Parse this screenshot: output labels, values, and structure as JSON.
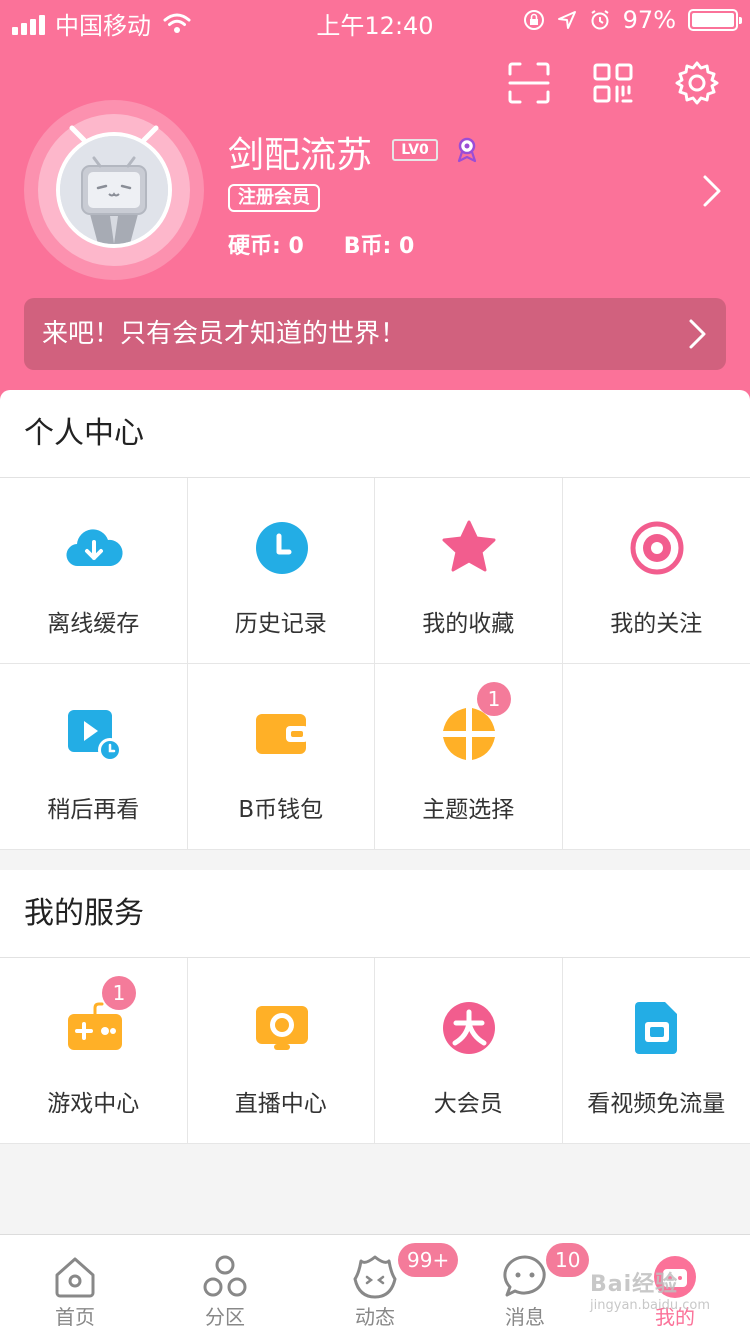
{
  "status_bar": {
    "carrier": "中国移动",
    "time": "上午12:40",
    "battery": "97%"
  },
  "profile": {
    "username": "剑配流苏",
    "level": "LV0",
    "member_tag": "注册会员",
    "coins_label": "硬币: 0",
    "bcoins_label": "B币: 0"
  },
  "vip_banner": {
    "text": "来吧！只有会员才知道的世界！"
  },
  "personal_center": {
    "title": "个人中心",
    "items": [
      {
        "label": "离线缓存",
        "icon": "download-cloud-icon",
        "color": "#23ade5"
      },
      {
        "label": "历史记录",
        "icon": "clock-icon",
        "color": "#23ade5"
      },
      {
        "label": "我的收藏",
        "icon": "star-icon",
        "color": "#f25d8e"
      },
      {
        "label": "我的关注",
        "icon": "follow-target-icon",
        "color": "#f25d8e"
      },
      {
        "label": "稍后再看",
        "icon": "watch-later-icon",
        "color": "#23ade5"
      },
      {
        "label": "B币钱包",
        "icon": "wallet-icon",
        "color": "#ffb027"
      },
      {
        "label": "主题选择",
        "icon": "theme-icon",
        "color": "#ffb027",
        "badge": "1"
      }
    ]
  },
  "my_services": {
    "title": "我的服务",
    "items": [
      {
        "label": "游戏中心",
        "icon": "gamepad-icon",
        "color": "#ffb027",
        "badge": "1"
      },
      {
        "label": "直播中心",
        "icon": "live-tv-icon",
        "color": "#ffb027"
      },
      {
        "label": "大会员",
        "icon": "big-vip-icon",
        "color": "#f25d8e"
      },
      {
        "label": "看视频免流量",
        "icon": "sim-card-icon",
        "color": "#23ade5"
      }
    ]
  },
  "tabbar": {
    "tabs": [
      {
        "label": "首页",
        "icon": "home-icon"
      },
      {
        "label": "分区",
        "icon": "category-icon"
      },
      {
        "label": "动态",
        "icon": "dynamic-icon",
        "badge": "99+"
      },
      {
        "label": "消息",
        "icon": "message-icon",
        "badge": "10"
      },
      {
        "label": "我的",
        "icon": "profile-tv-icon",
        "active": true
      }
    ]
  },
  "watermark": {
    "brand": "Bai经验",
    "url": "jingyan.baidu.com"
  },
  "colors": {
    "brand_pink": "#fb7299",
    "banner_bg": "#d1617e",
    "blue": "#23ade5",
    "yellow": "#ffb027",
    "pink": "#f25d8e"
  }
}
